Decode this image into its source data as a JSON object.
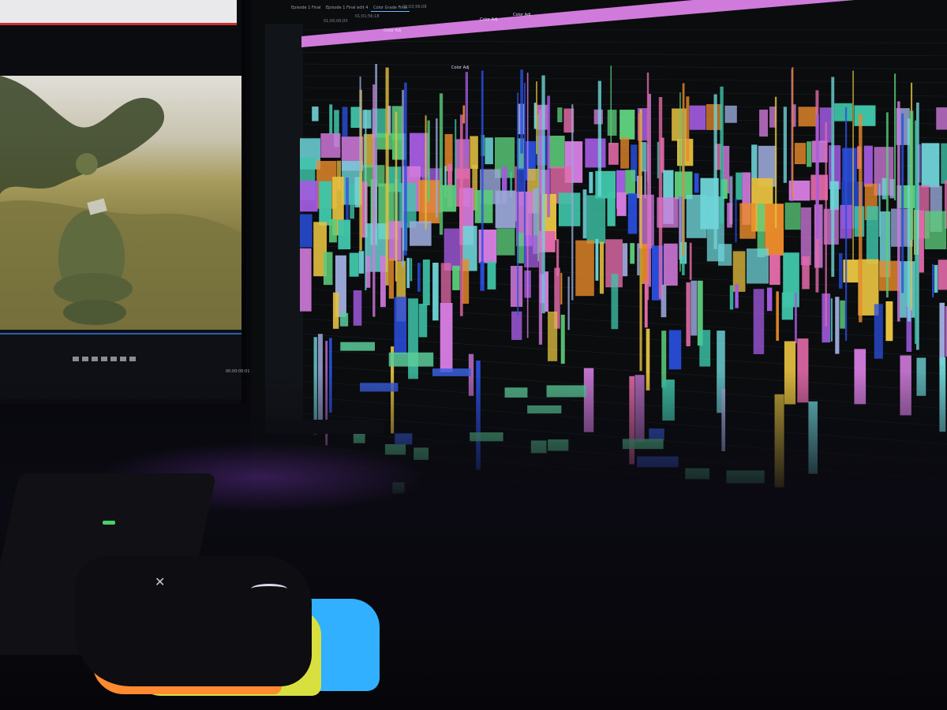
{
  "scene": {
    "description_type": "photo-of-monitors",
    "colors": {
      "background": "#07080c",
      "accent_purple": "#d07adb",
      "accent_teal": "#3fc4a8",
      "accent_blue": "#2a4fe0",
      "accent_orange": "#e98a2a",
      "accent_green": "#5ccc7a"
    }
  },
  "left_monitor": {
    "timecode": "00:00:00:01"
  },
  "right_monitor": {
    "tabs": [
      "Episode 1 Final",
      "Episode 1 Final edit 4",
      "Color Grade Final"
    ],
    "timecodes": [
      "01;00;00;00",
      "01;01;56;18",
      "01;03;56;08"
    ],
    "markers": [
      "Color Adj",
      "Color Adj",
      "Color Adj",
      "Color Adj"
    ]
  },
  "icons": {
    "mouse_logo": "hyperx-icon",
    "playhead": "playhead-icon"
  }
}
